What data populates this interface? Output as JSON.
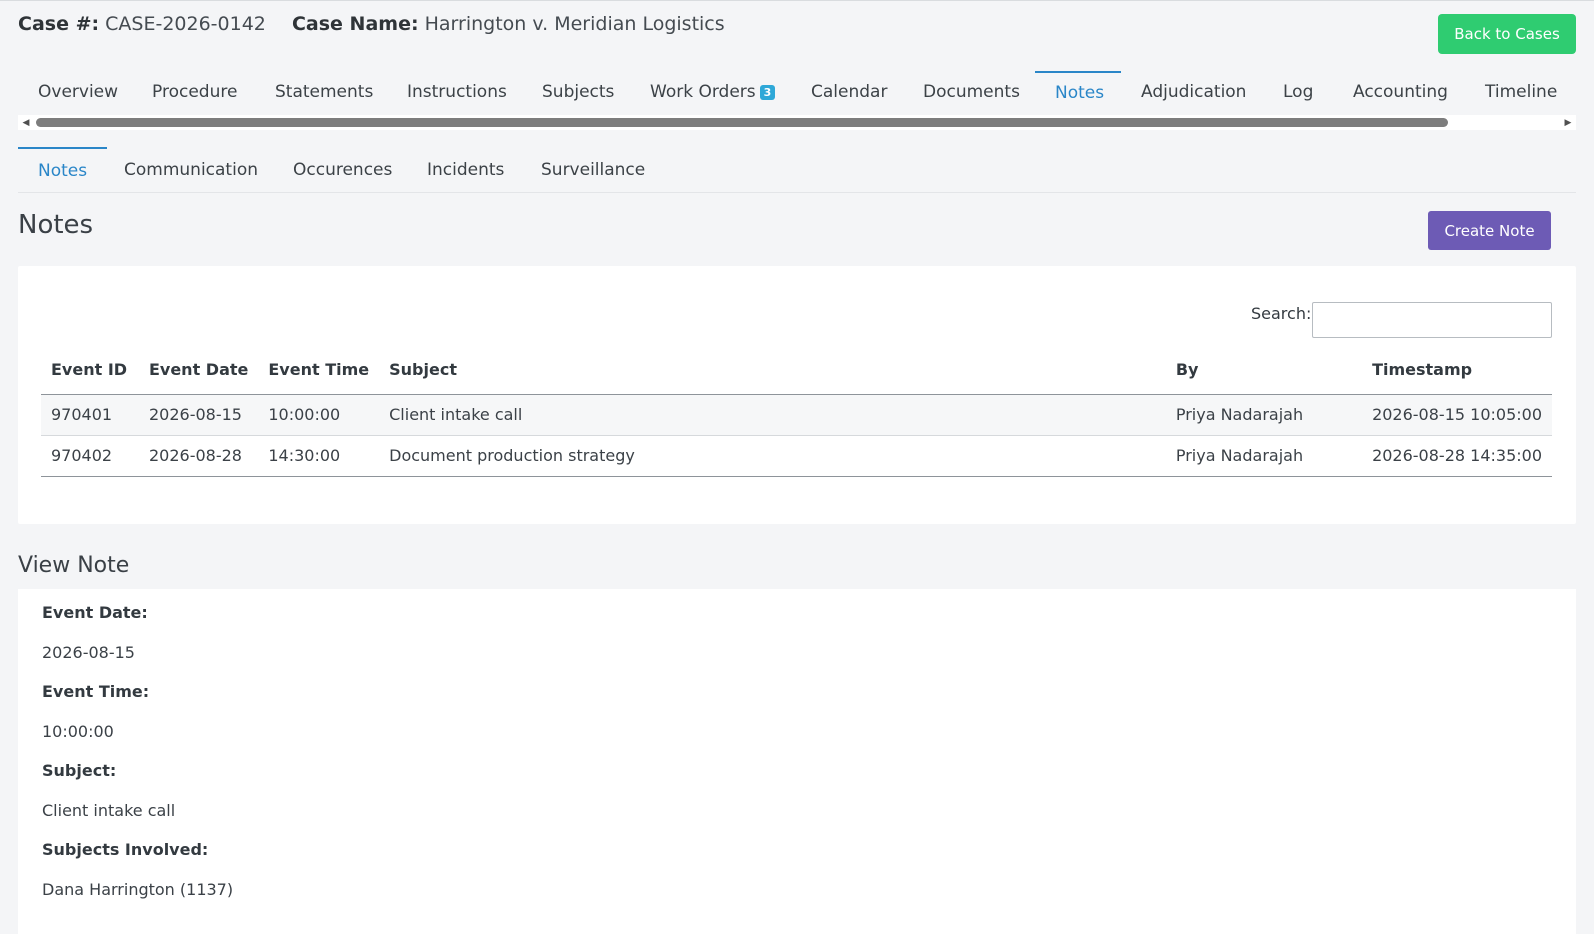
{
  "header": {
    "case_number_label": "Case #:",
    "case_number": "CASE-2026-0142",
    "case_name_label": "Case Name:",
    "case_name": "Harrington v. Meridian Logistics",
    "back_button": "Back to Cases"
  },
  "tabs": [
    {
      "label": "Overview"
    },
    {
      "label": "Procedure"
    },
    {
      "label": "Statements"
    },
    {
      "label": "Instructions"
    },
    {
      "label": "Subjects"
    },
    {
      "label": "Work Orders",
      "badge": "3"
    },
    {
      "label": "Calendar"
    },
    {
      "label": "Documents"
    },
    {
      "label": "Notes",
      "active": true
    },
    {
      "label": "Adjudication"
    },
    {
      "label": "Log"
    },
    {
      "label": "Accounting"
    },
    {
      "label": "Timeline"
    }
  ],
  "subtabs": [
    {
      "label": "Notes",
      "active": true
    },
    {
      "label": "Communication"
    },
    {
      "label": "Occurences"
    },
    {
      "label": "Incidents"
    },
    {
      "label": "Surveillance"
    }
  ],
  "notes": {
    "title": "Notes",
    "create_button": "Create Note",
    "search_label": "Search:",
    "search_value": "",
    "columns": [
      "Event ID",
      "Event Date",
      "Event Time",
      "Subject",
      "By",
      "Timestamp"
    ],
    "rows": [
      [
        "970401",
        "2026-08-15",
        "10:00:00",
        "Client intake call",
        "Priya Nadarajah",
        "2026-08-15 10:05:00"
      ],
      [
        "970402",
        "2026-08-28",
        "14:30:00",
        "Document production strategy",
        "Priya Nadarajah",
        "2026-08-28 14:35:00"
      ]
    ]
  },
  "view_note": {
    "title": "View Note",
    "event_date_label": "Event Date:",
    "event_date": "2026-08-15",
    "event_time_label": "Event Time:",
    "event_time": "10:00:00",
    "subject_label": "Subject:",
    "subject": "Client intake call",
    "subjects_involved_label": "Subjects Involved:",
    "subjects_involved": "Dana Harrington (1137)"
  },
  "colors": {
    "accent": "#2a86c8",
    "back_button": "#2fcc71",
    "create_button": "#6d5bb5",
    "badge": "#2ea8d8"
  }
}
